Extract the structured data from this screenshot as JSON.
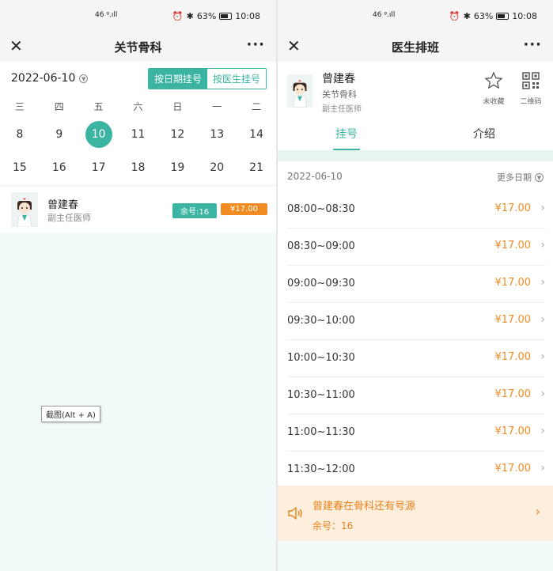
{
  "status_bar": {
    "network": "46 ᵍ.ıll",
    "battery": "63%",
    "time": "10:08"
  },
  "left": {
    "nav": {
      "title": "关节骨科"
    },
    "date": {
      "selected": "2022-06-10"
    },
    "mode_tabs": {
      "by_date": "按日期挂号",
      "by_doctor": "按医生挂号"
    },
    "weekdays": [
      "三",
      "四",
      "五",
      "六",
      "日",
      "一",
      "二"
    ],
    "week1": [
      "8",
      "9",
      "10",
      "11",
      "12",
      "13",
      "14"
    ],
    "week2": [
      "15",
      "16",
      "17",
      "18",
      "19",
      "20",
      "21"
    ],
    "selected_day": "10",
    "doctor": {
      "name": "曾建春",
      "title": "副主任医师",
      "remaining": "余号:16",
      "price": "¥17.00"
    },
    "tooltip": "截图(Alt + A)"
  },
  "right": {
    "nav": {
      "title": "医生排班"
    },
    "doctor": {
      "name": "曾建春",
      "dept": "关节骨科",
      "title": "副主任医师"
    },
    "favorite_label": "未收藏",
    "qrcode_label": "二维码",
    "tabs": {
      "register": "挂号",
      "intro": "介绍"
    },
    "schedule_date": "2022-06-10",
    "more_dates": "更多日期",
    "slots": [
      {
        "time": "08:00~08:30",
        "price": "¥17.00"
      },
      {
        "time": "08:30~09:00",
        "price": "¥17.00"
      },
      {
        "time": "09:00~09:30",
        "price": "¥17.00"
      },
      {
        "time": "09:30~10:00",
        "price": "¥17.00"
      },
      {
        "time": "10:00~10:30",
        "price": "¥17.00"
      },
      {
        "time": "10:30~11:00",
        "price": "¥17.00"
      },
      {
        "time": "11:00~11:30",
        "price": "¥17.00"
      },
      {
        "time": "11:30~12:00",
        "price": "¥17.00"
      }
    ],
    "notice": {
      "message": "曾建春在骨科还有号源",
      "remaining": "余号：16"
    }
  },
  "colors": {
    "accent": "#3bb5a1",
    "price": "#f08c21",
    "notice_bg": "#fdeede",
    "page_bg": "#f1faf8"
  }
}
